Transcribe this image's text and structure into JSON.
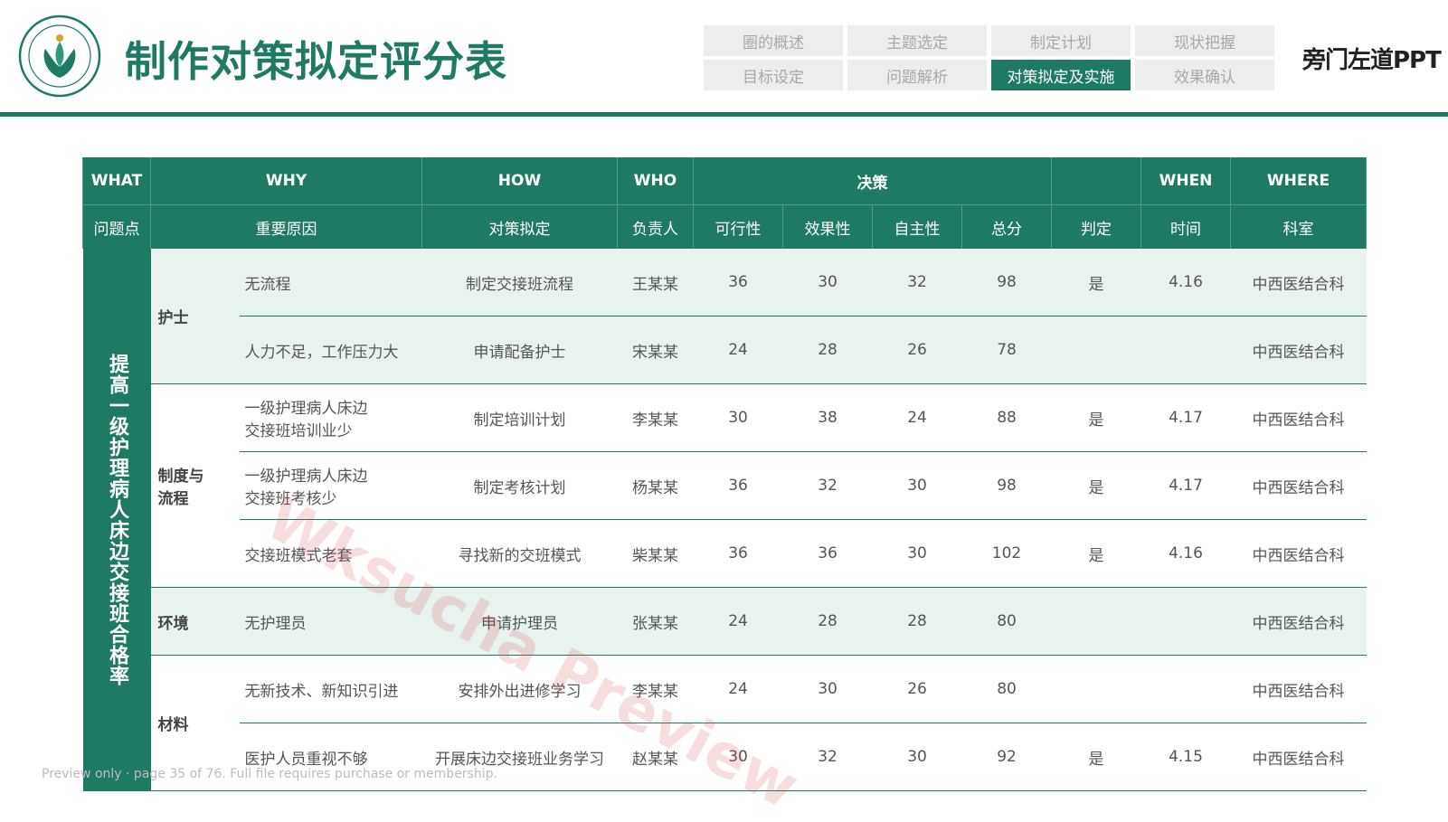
{
  "header": {
    "title": "制作对策拟定评分表",
    "brand": "旁门左道PPT",
    "nav": [
      {
        "label": "圈的概述",
        "active": false
      },
      {
        "label": "主题选定",
        "active": false
      },
      {
        "label": "制定计划",
        "active": false
      },
      {
        "label": "现状把握",
        "active": false
      },
      {
        "label": "目标设定",
        "active": false
      },
      {
        "label": "问题解析",
        "active": false
      },
      {
        "label": "对策拟定及实施",
        "active": true
      },
      {
        "label": "效果确认",
        "active": false
      }
    ]
  },
  "colors": {
    "accent": "#1f7a64",
    "row_shade": "#e8f2ef",
    "nav_bg": "#ededed",
    "nav_text": "#a8a8a8"
  },
  "table": {
    "header_row1": {
      "what": "WHAT",
      "why": "WHY",
      "how": "HOW",
      "who": "WHO",
      "decision": "决策",
      "judge_blank": "",
      "when": "WHEN",
      "where": "WHERE"
    },
    "header_row2": [
      "问题点",
      "重要原因",
      "对策拟定",
      "负责人",
      "可行性",
      "效果性",
      "自主性",
      "总分",
      "判定",
      "时间",
      "科室"
    ],
    "what_text": "提高一级护理病人床边交接班合格率",
    "categories": [
      {
        "name": "护士"
      },
      {
        "name": "制度与\n流程"
      },
      {
        "name": "环境"
      },
      {
        "name": "材料"
      }
    ],
    "rows": [
      {
        "reason": "无流程",
        "measure": "制定交接班流程",
        "owner": "王某某",
        "feasibility": "36",
        "effect": "30",
        "autonomy": "32",
        "total": "98",
        "judge": "是",
        "time": "4.16",
        "dept": "中西医结合科"
      },
      {
        "reason": "人力不足，工作压力大",
        "measure": "申请配备护士",
        "owner": "宋某某",
        "feasibility": "24",
        "effect": "28",
        "autonomy": "26",
        "total": "78",
        "judge": "",
        "time": "",
        "dept": "中西医结合科"
      },
      {
        "reason": "一级护理病人床边\n交接班培训业少",
        "measure": "制定培训计划",
        "owner": "李某某",
        "feasibility": "30",
        "effect": "38",
        "autonomy": "24",
        "total": "88",
        "judge": "是",
        "time": "4.17",
        "dept": "中西医结合科"
      },
      {
        "reason": "一级护理病人床边\n交接班考核少",
        "measure": "制定考核计划",
        "owner": "杨某某",
        "feasibility": "36",
        "effect": "32",
        "autonomy": "30",
        "total": "98",
        "judge": "是",
        "time": "4.17",
        "dept": "中西医结合科"
      },
      {
        "reason": "交接班模式老套",
        "measure": "寻找新的交班模式",
        "owner": "柴某某",
        "feasibility": "36",
        "effect": "36",
        "autonomy": "30",
        "total": "102",
        "judge": "是",
        "time": "4.16",
        "dept": "中西医结合科"
      },
      {
        "reason": "无护理员",
        "measure": "申请护理员",
        "owner": "张某某",
        "feasibility": "24",
        "effect": "28",
        "autonomy": "28",
        "total": "80",
        "judge": "",
        "time": "",
        "dept": "中西医结合科"
      },
      {
        "reason": "无新技术、新知识引进",
        "measure": "安排外出进修学习",
        "owner": "李某某",
        "feasibility": "24",
        "effect": "30",
        "autonomy": "26",
        "total": "80",
        "judge": "",
        "time": "",
        "dept": "中西医结合科"
      },
      {
        "reason": "医护人员重视不够",
        "measure": "开展床边交接班业务学习",
        "owner": "赵某某",
        "feasibility": "30",
        "effect": "32",
        "autonomy": "30",
        "total": "92",
        "judge": "是",
        "time": "4.15",
        "dept": "中西医结合科"
      }
    ]
  },
  "watermark": "Wksucha Preview",
  "footer_note": "Preview only · page 35 of 76. Full file requires purchase or membership."
}
